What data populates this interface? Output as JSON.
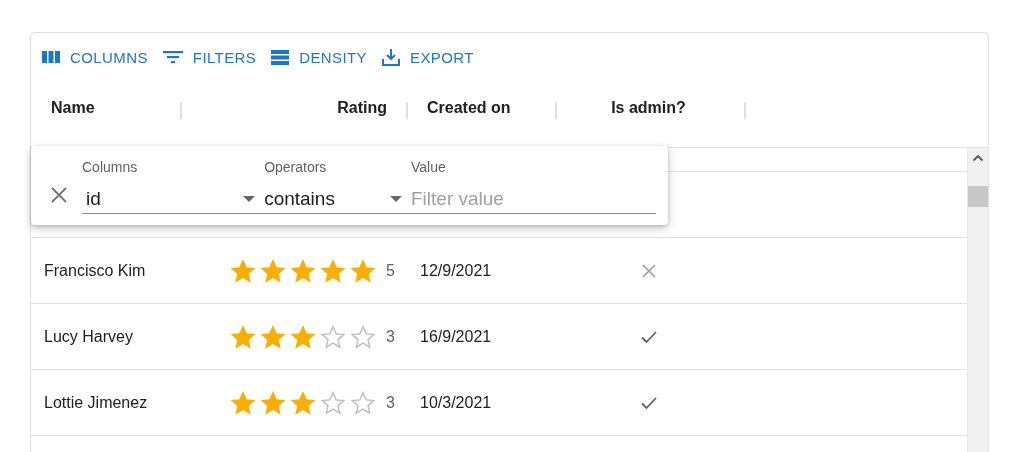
{
  "toolbar": [
    {
      "label": "COLUMNS",
      "kind": "columns"
    },
    {
      "label": "FILTERS",
      "kind": "filters"
    },
    {
      "label": "DENSITY",
      "kind": "density"
    },
    {
      "label": "EXPORT",
      "kind": "export"
    }
  ],
  "columns": [
    "Name",
    "Rating",
    "Created on",
    "Is admin?"
  ],
  "rows": [
    {
      "name": "Francisco Kim",
      "stars": 5,
      "rating": "5",
      "created_on": "12/9/2021",
      "is_admin": false
    },
    {
      "name": "Lucy Harvey",
      "stars": 3,
      "rating": "3",
      "created_on": "16/9/2021",
      "is_admin": true
    },
    {
      "name": "Lottie Jimenez",
      "stars": 3,
      "rating": "3",
      "created_on": "10/3/2021",
      "is_admin": true
    }
  ],
  "filter_panel": {
    "columns_label": "Columns",
    "columns_value": "id",
    "operators_label": "Operators",
    "operators_value": "contains",
    "value_label": "Value",
    "value_placeholder": "Filter value"
  }
}
